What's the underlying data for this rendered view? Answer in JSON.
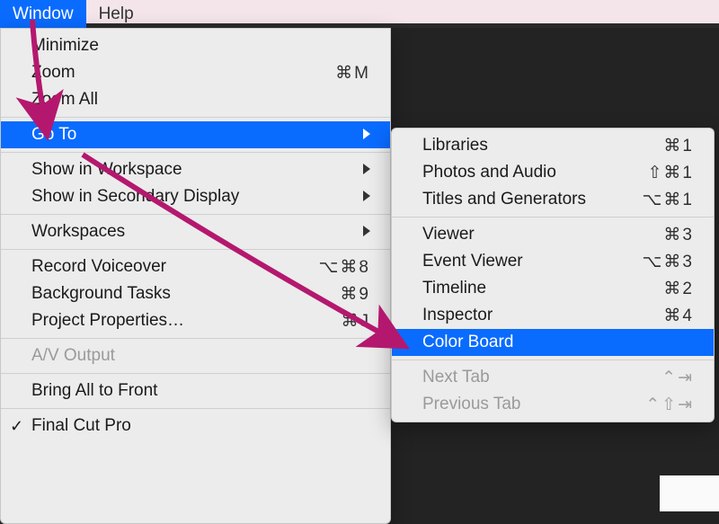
{
  "menubar": {
    "window": "Window",
    "help": "Help"
  },
  "mainMenu": {
    "minimize": "Minimize",
    "zoom": "Zoom",
    "zoom_sc": "⌘M",
    "zoomAll": "Zoom All",
    "goto": "Go To",
    "showWs": "Show in Workspace",
    "showSec": "Show in Secondary Display",
    "workspaces": "Workspaces",
    "recordVO": "Record Voiceover",
    "recordVO_sc": "⌥⌘8",
    "bgTasks": "Background Tasks",
    "bgTasks_sc": "⌘9",
    "projProps": "Project Properties…",
    "projProps_sc": "⌘J",
    "avOutput": "A/V Output",
    "bringFront": "Bring All to Front",
    "fcp": "Final Cut Pro"
  },
  "subMenu": {
    "libraries": "Libraries",
    "libraries_sc": "⌘1",
    "photos": "Photos and Audio",
    "photos_sc": "⇧⌘1",
    "titles": "Titles and Generators",
    "titles_sc": "⌥⌘1",
    "viewer": "Viewer",
    "viewer_sc": "⌘3",
    "eventViewer": "Event Viewer",
    "eventViewer_sc": "⌥⌘3",
    "timeline": "Timeline",
    "timeline_sc": "⌘2",
    "inspector": "Inspector",
    "inspector_sc": "⌘4",
    "colorBoard": "Color Board",
    "nextTab": "Next Tab",
    "nextTab_sc": "⌃⇥",
    "prevTab": "Previous Tab",
    "prevTab_sc": "⌃⇧⇥"
  },
  "annotation": {
    "color": "#b4186e"
  }
}
